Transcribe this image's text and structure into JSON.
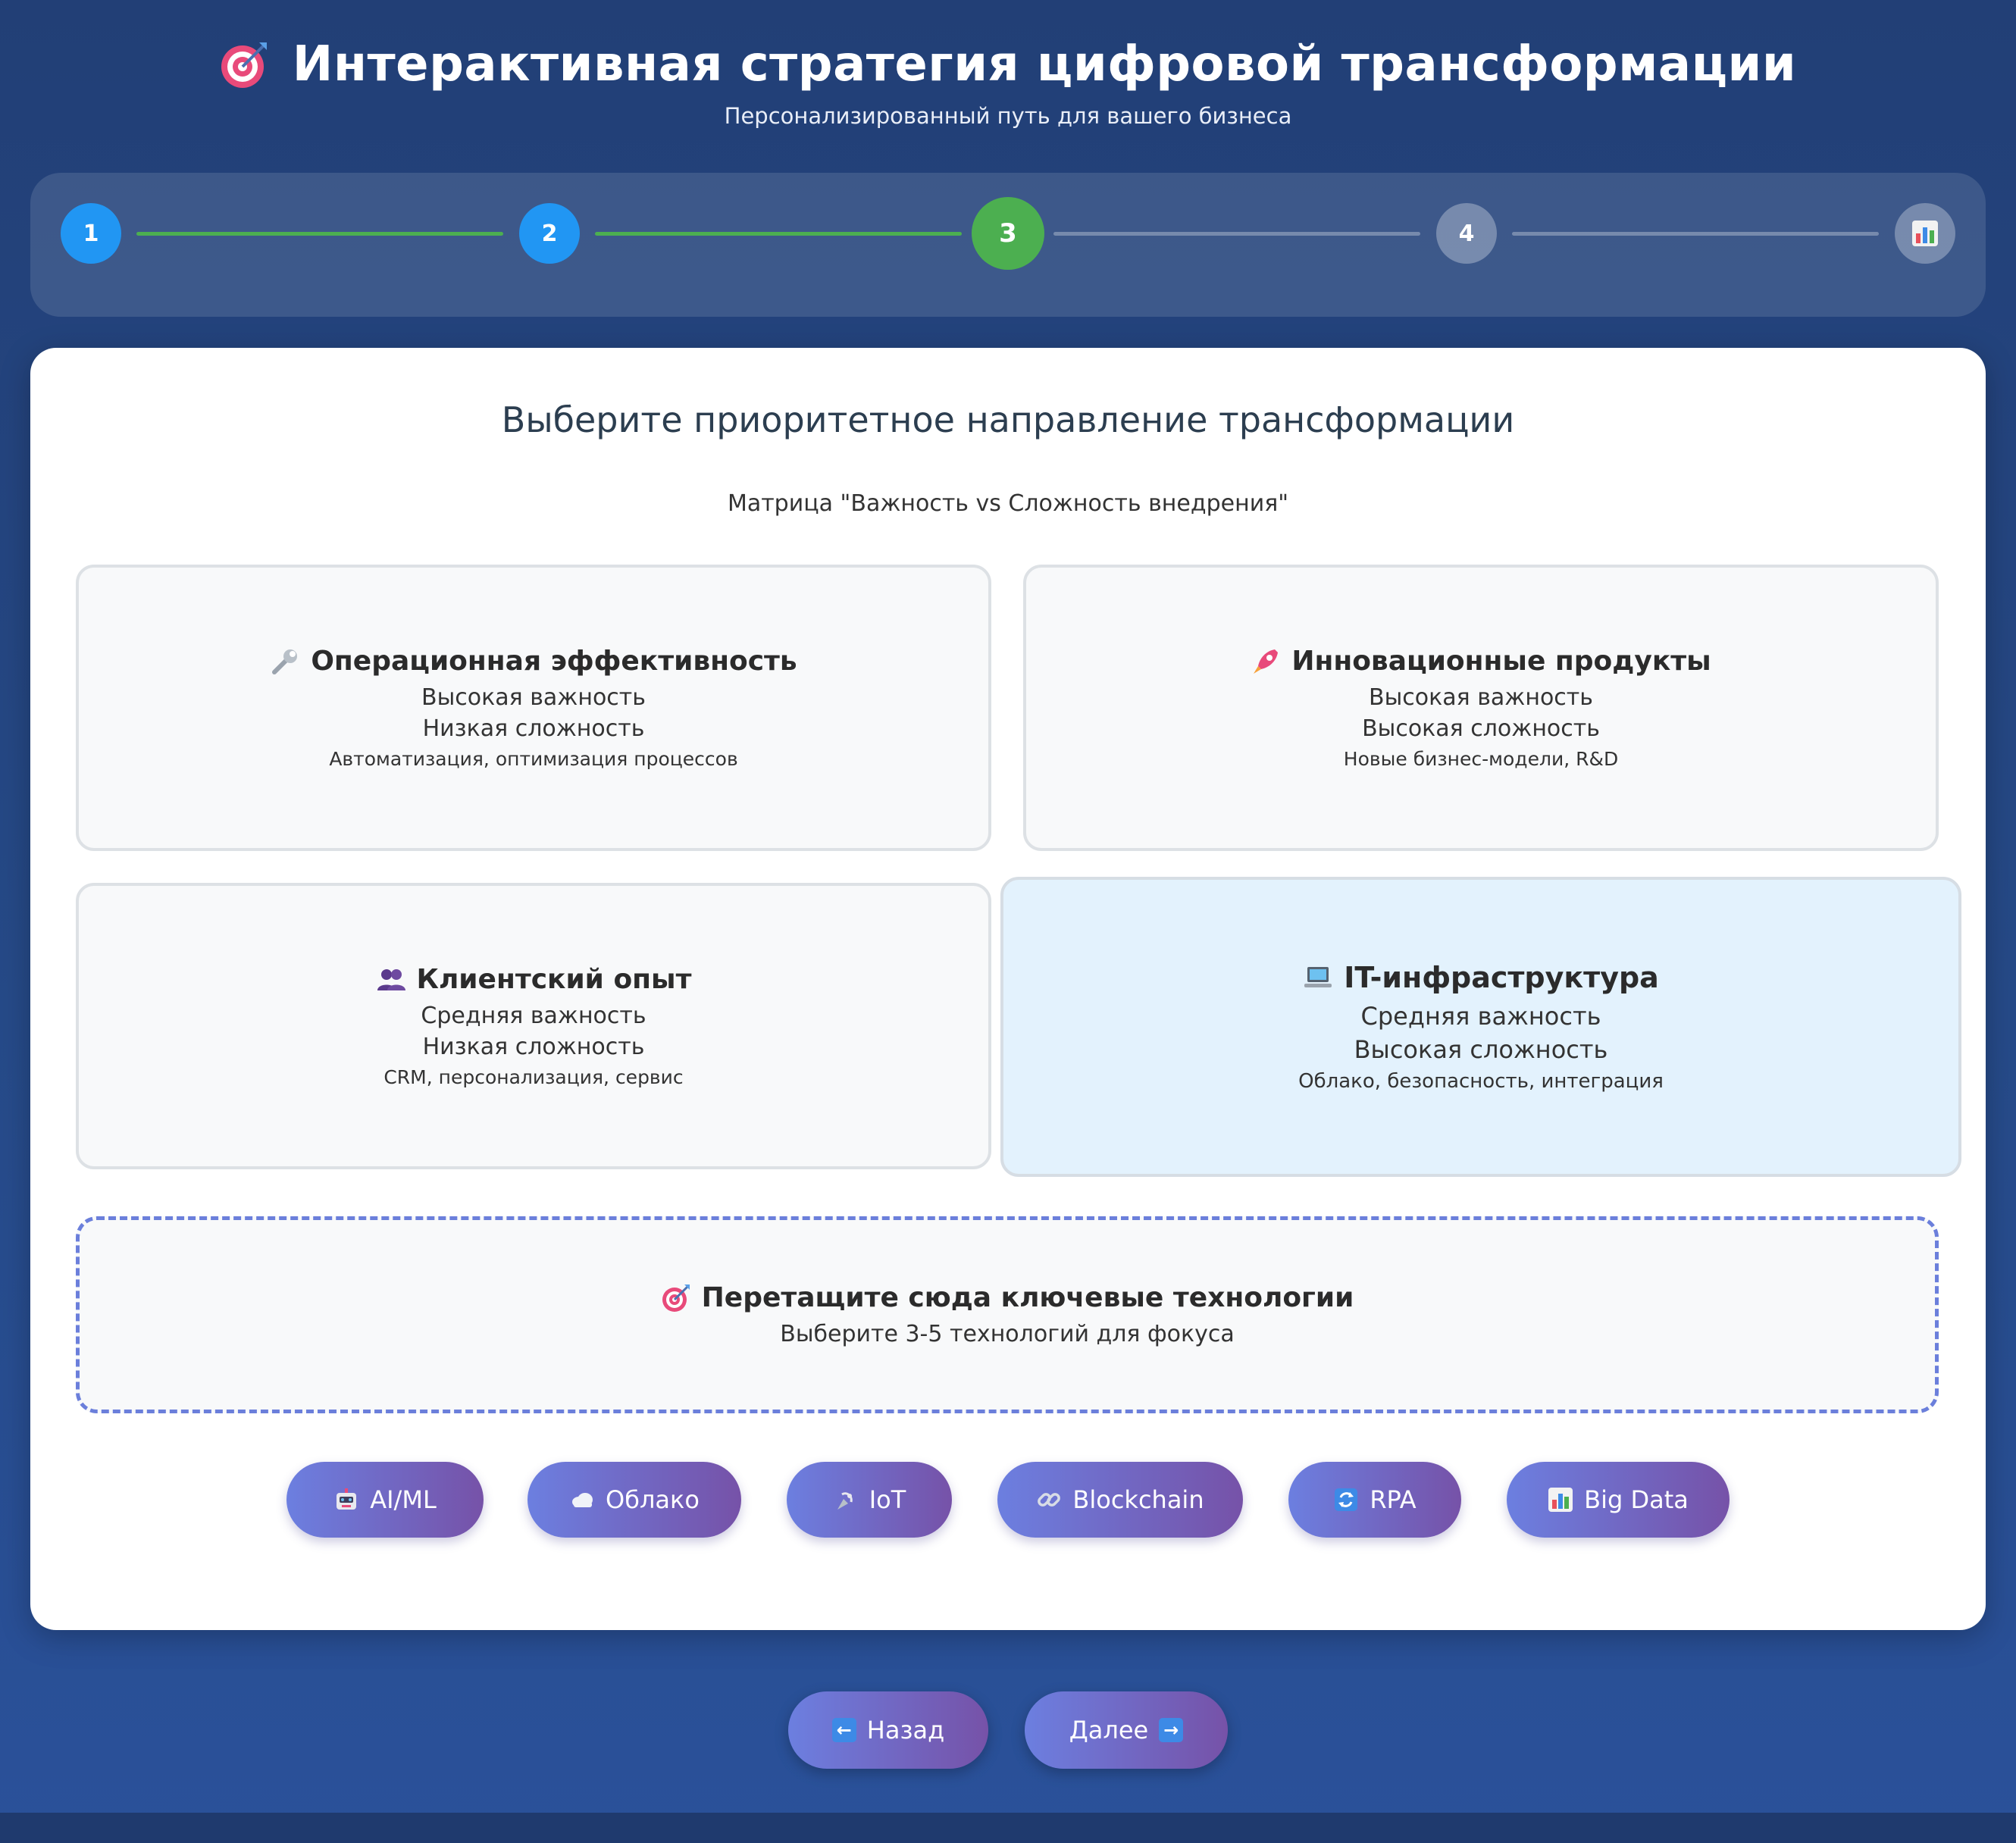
{
  "header": {
    "title": "Интерактивная стратегия цифровой трансформации",
    "subtitle": "Персонализированный путь для вашего бизнеса",
    "icon": "target-icon"
  },
  "progress": {
    "steps": [
      {
        "label": "1",
        "state": "done"
      },
      {
        "label": "2",
        "state": "done"
      },
      {
        "label": "3",
        "state": "active"
      },
      {
        "label": "4",
        "state": "todo"
      },
      {
        "label": "",
        "state": "todo",
        "icon": "chart-icon"
      }
    ],
    "colors": {
      "done": "#2196f3",
      "active": "#4caf50",
      "line_done": "#4caf50"
    }
  },
  "card": {
    "title": "Выберите приоритетное направление трансформации",
    "caption": "Матрица \"Важность vs Сложность внедрения\""
  },
  "quadrants": [
    {
      "icon": "wrench-icon",
      "title": "Операционная эффективность",
      "importance": "Высокая важность",
      "complexity": "Низкая сложность",
      "description": "Автоматизация, оптимизация процессов",
      "selected": false
    },
    {
      "icon": "rocket-icon",
      "title": "Инновационные продукты",
      "importance": "Высокая важность",
      "complexity": "Высокая сложность",
      "description": "Новые бизнес-модели, R&D",
      "selected": false
    },
    {
      "icon": "users-icon",
      "title": "Клиентский опыт",
      "importance": "Средняя важность",
      "complexity": "Низкая сложность",
      "description": "CRM, персонализация, сервис",
      "selected": false
    },
    {
      "icon": "laptop-icon",
      "title": "IT-инфраструктура",
      "importance": "Средняя важность",
      "complexity": "Высокая сложность",
      "description": "Облако, безопасность, интеграция",
      "selected": true
    }
  ],
  "dropzone": {
    "icon": "target-icon",
    "title": "Перетащите сюда ключевые технологии",
    "subtitle": "Выберите 3-5 технологий для фокуса"
  },
  "technologies": [
    {
      "icon": "robot-icon",
      "label": "AI/ML"
    },
    {
      "icon": "cloud-icon",
      "label": "Облако"
    },
    {
      "icon": "antenna-icon",
      "label": "IoT"
    },
    {
      "icon": "link-icon",
      "label": "Blockchain"
    },
    {
      "icon": "refresh-icon",
      "label": "RPA"
    },
    {
      "icon": "chart-icon",
      "label": "Big Data"
    }
  ],
  "nav": {
    "back_label": "Назад",
    "next_label": "Далее"
  }
}
